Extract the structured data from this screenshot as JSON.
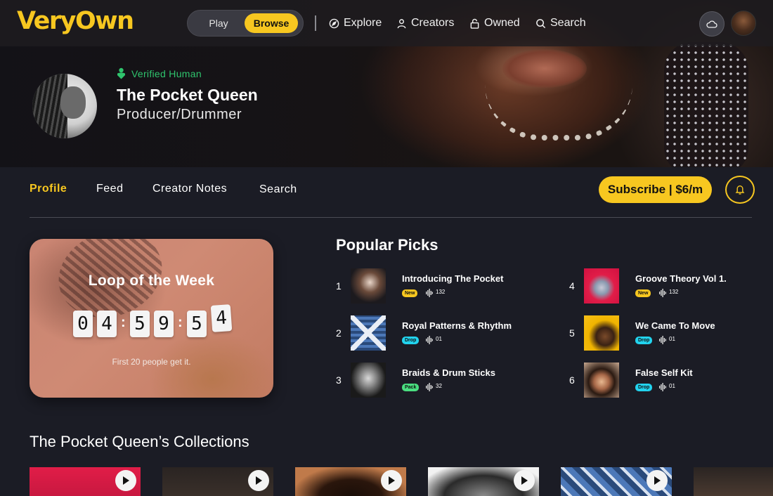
{
  "app": {
    "logo": "VeryOwn"
  },
  "topnav": {
    "mode_toggle": {
      "play": "Play",
      "browse": "Browse",
      "selected": "Browse"
    },
    "links": [
      {
        "label": "Explore",
        "icon": "compass-icon"
      },
      {
        "label": "Creators",
        "icon": "person-icon"
      },
      {
        "label": "Owned",
        "icon": "lock-icon"
      },
      {
        "label": "Search",
        "icon": "search-icon"
      }
    ],
    "cloud_icon": "cloud-icon",
    "avatar_icon": "user-avatar"
  },
  "profile": {
    "verified_label": "Verified Human",
    "name": "The Pocket Queen",
    "role": "Producer/Drummer"
  },
  "tabs": [
    {
      "label": "Profile",
      "active": true
    },
    {
      "label": "Feed",
      "active": false
    },
    {
      "label": "Creator Notes",
      "active": false
    },
    {
      "label": "Search",
      "active": false
    }
  ],
  "subscribe": {
    "label": "Subscribe | $6/m"
  },
  "loop_of_week": {
    "title": "Loop of the Week",
    "timer_digits": [
      "0",
      "4",
      "5",
      "9",
      "5",
      "4"
    ],
    "subtitle": "First 20 people get it."
  },
  "popular_picks": {
    "title": "Popular Picks",
    "items": [
      {
        "rank": "1",
        "title": "Introducing The Pocket",
        "badge": "New",
        "badge_color": "#f7c720",
        "count": "132"
      },
      {
        "rank": "2",
        "title": "Royal Patterns & Rhythm",
        "badge": "Drop",
        "badge_color": "#22d3ee",
        "count": "01"
      },
      {
        "rank": "3",
        "title": "Braids & Drum Sticks",
        "badge": "Pack",
        "badge_color": "#4ade80",
        "count": "32"
      },
      {
        "rank": "4",
        "title": "Groove Theory Vol 1.",
        "badge": "New",
        "badge_color": "#f7c720",
        "count": "132"
      },
      {
        "rank": "5",
        "title": "We Came To Move",
        "badge": "Drop",
        "badge_color": "#22d3ee",
        "count": "01"
      },
      {
        "rank": "6",
        "title": "False Self Kit",
        "badge": "Drop",
        "badge_color": "#22d3ee",
        "count": "01"
      }
    ]
  },
  "collections": {
    "title": "The Pocket Queen’s Collections",
    "count_visible": 6
  },
  "colors": {
    "accent": "#f7c720",
    "background": "#1b1c25",
    "verified": "#2fc46d"
  }
}
